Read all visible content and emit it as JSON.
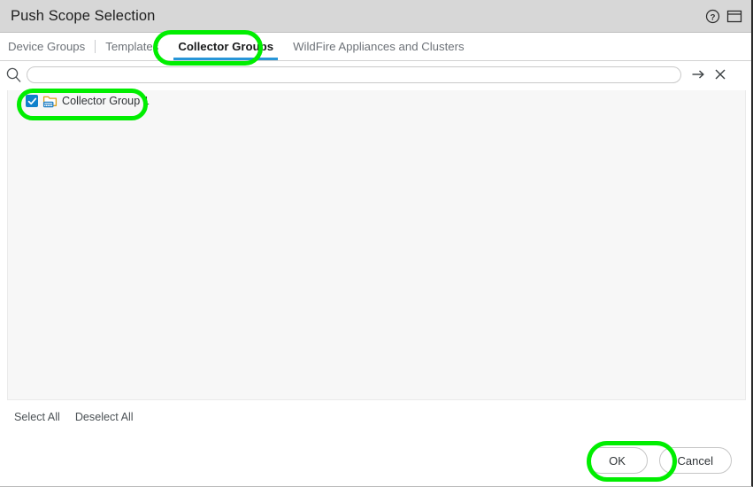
{
  "window": {
    "title": "Push Scope Selection",
    "help_icon": "help-circle-icon",
    "restore_icon": "window-restore-icon"
  },
  "tabs": [
    {
      "label": "Device Groups",
      "active": false,
      "name": "tab-device-groups"
    },
    {
      "label": "Templates",
      "active": false,
      "name": "tab-templates"
    },
    {
      "label": "Collector Groups",
      "active": true,
      "name": "tab-collector-groups"
    },
    {
      "label": "WildFire Appliances and Clusters",
      "active": false,
      "name": "tab-wildfire-appliances-and-clusters"
    }
  ],
  "search": {
    "value": "",
    "placeholder": "",
    "search_icon": "search-icon",
    "apply_icon": "arrow-right-icon",
    "clear_icon": "close-icon"
  },
  "list": {
    "items": [
      {
        "label": "Collector Group 1",
        "checked": true,
        "icon": "collector-group-folder-icon"
      }
    ]
  },
  "actions": {
    "select_all": "Select All",
    "deselect_all": "Deselect All"
  },
  "footer": {
    "ok": "OK",
    "cancel": "Cancel"
  },
  "colors": {
    "active_tab_underline": "#2896d8",
    "checkbox": "#0f81cb",
    "annotation_ring": "#00ee00",
    "titlebar": "#d7d7d7",
    "panel": "#f7f7f7",
    "folder_icon": "#d99d18",
    "device_icon": "#1f7fc4"
  }
}
